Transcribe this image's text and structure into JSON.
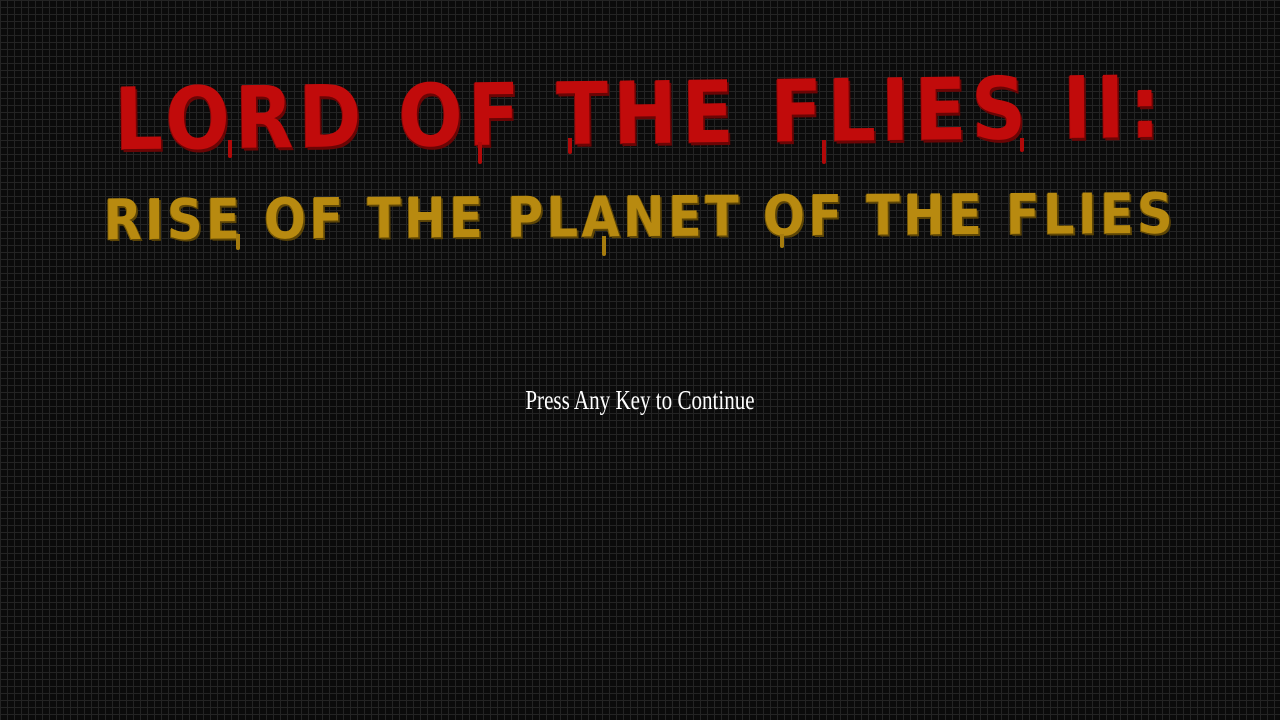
{
  "title_screen": {
    "main_title": "Lord of the Flies II:",
    "subtitle": "Rise of the Planet of the Flies",
    "prompt": "Press Any Key to Continue"
  },
  "colors": {
    "background": "#0b0b0b",
    "grid": "#242424",
    "main_title": "#c10b0b",
    "subtitle": "#b88a10",
    "prompt": "#ffffff"
  }
}
